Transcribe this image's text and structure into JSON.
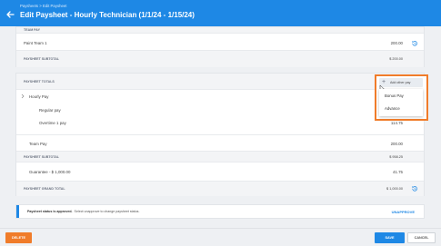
{
  "header": {
    "breadcrumb": "Paysheets > Edit Paysheet",
    "title": "Edit Paysheet - Hourly Technician (1/1/24 - 1/15/24)"
  },
  "team_pay_section": {
    "heading": "TEAM PAY",
    "rows": [
      {
        "label": "Paint Team 1",
        "value": "200.00"
      }
    ],
    "subtotal_label": "PAYSHEET SUBTOTAL",
    "subtotal_value": "$ 200.00"
  },
  "totals_section": {
    "heading": "PAYSHEET TOTALS",
    "hourly_pay_label": "Hourly Pay",
    "regular_pay_label": "Regular pay",
    "overtime_label": "Overtime 1 pay",
    "overtime_value": "114.75",
    "team_pay_label": "Team Pay",
    "team_pay_value": "200.00",
    "subtotal_label": "PAYSHEET SUBTOTAL",
    "subtotal_value": "$ 958.25",
    "guarantee_label": "Guarantee - $ 1,000.00",
    "guarantee_value": "41.75",
    "grand_total_label": "PAYSHEET GRAND TOTAL",
    "grand_total_value": "$ 1,000.00"
  },
  "popup": {
    "add_other_pay_label": "Add other pay",
    "menu_items": [
      "Bonus Pay",
      "Advance"
    ]
  },
  "notice": {
    "bold_text": "Paysheet status is approved.",
    "text": "Select unapprove to change paysheet status.",
    "action_label": "UNAPPROVE"
  },
  "footer": {
    "delete_label": "DELETE",
    "save_label": "SAVE",
    "cancel_label": "CANCEL"
  },
  "colors": {
    "header_blue": "#1e88e5",
    "accent_orange": "#f07c2a"
  },
  "icons": [
    "back-arrow-icon",
    "history-icon",
    "chevron-right-icon",
    "plus-icon",
    "cursor-icon"
  ]
}
